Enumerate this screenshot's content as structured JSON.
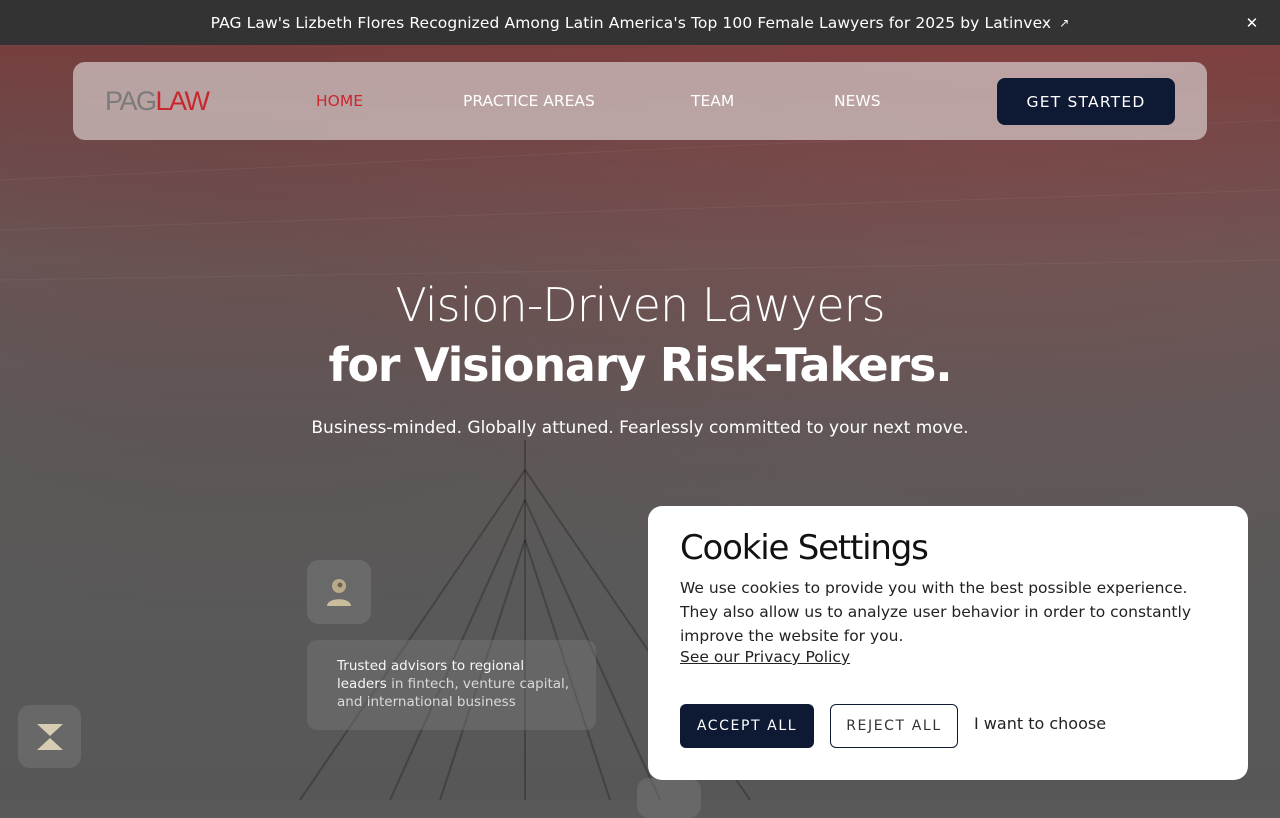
{
  "announcement": {
    "text": "PAG Law's Lizbeth Flores Recognized Among Latin America's Top 100 Female Lawyers for 2025 by Latinvex",
    "arrow_icon": "external-arrow-icon",
    "close_icon": "close-icon",
    "arrow_glyph": "↗",
    "close_glyph": "✕"
  },
  "nav": {
    "logo_pag": "PAG",
    "logo_law": "LAW",
    "items": [
      {
        "label": "HOME",
        "active": true
      },
      {
        "label": "PRACTICE AREAS",
        "active": false
      },
      {
        "label": "TEAM",
        "active": false
      },
      {
        "label": "NEWS",
        "active": false
      }
    ],
    "cta_label": "GET STARTED"
  },
  "hero": {
    "title_line1": "Vision-Driven Lawyers",
    "title_line2": "for Visionary Risk-Takers.",
    "subtitle": "Business-minded. Globally attuned. Fearlessly committed to your next move."
  },
  "feature": {
    "bold_text": "Trusted advisors to regional leaders",
    "rest_text": " in fintech, venture capital, and international business"
  },
  "cookie": {
    "title": "Cookie Settings",
    "body": "We use cookies to provide you with the best possible experience. They also allow us to analyze user behavior in order to constantly improve the website for you.",
    "policy_link": "See our Privacy Policy",
    "accept_label": "ACCEPT ALL",
    "reject_label": "REJECT ALL",
    "choose_label": "I want to choose"
  },
  "colors": {
    "brand_red": "#c8272e",
    "navy": "#0e1a33",
    "announce_bg": "#333333"
  }
}
